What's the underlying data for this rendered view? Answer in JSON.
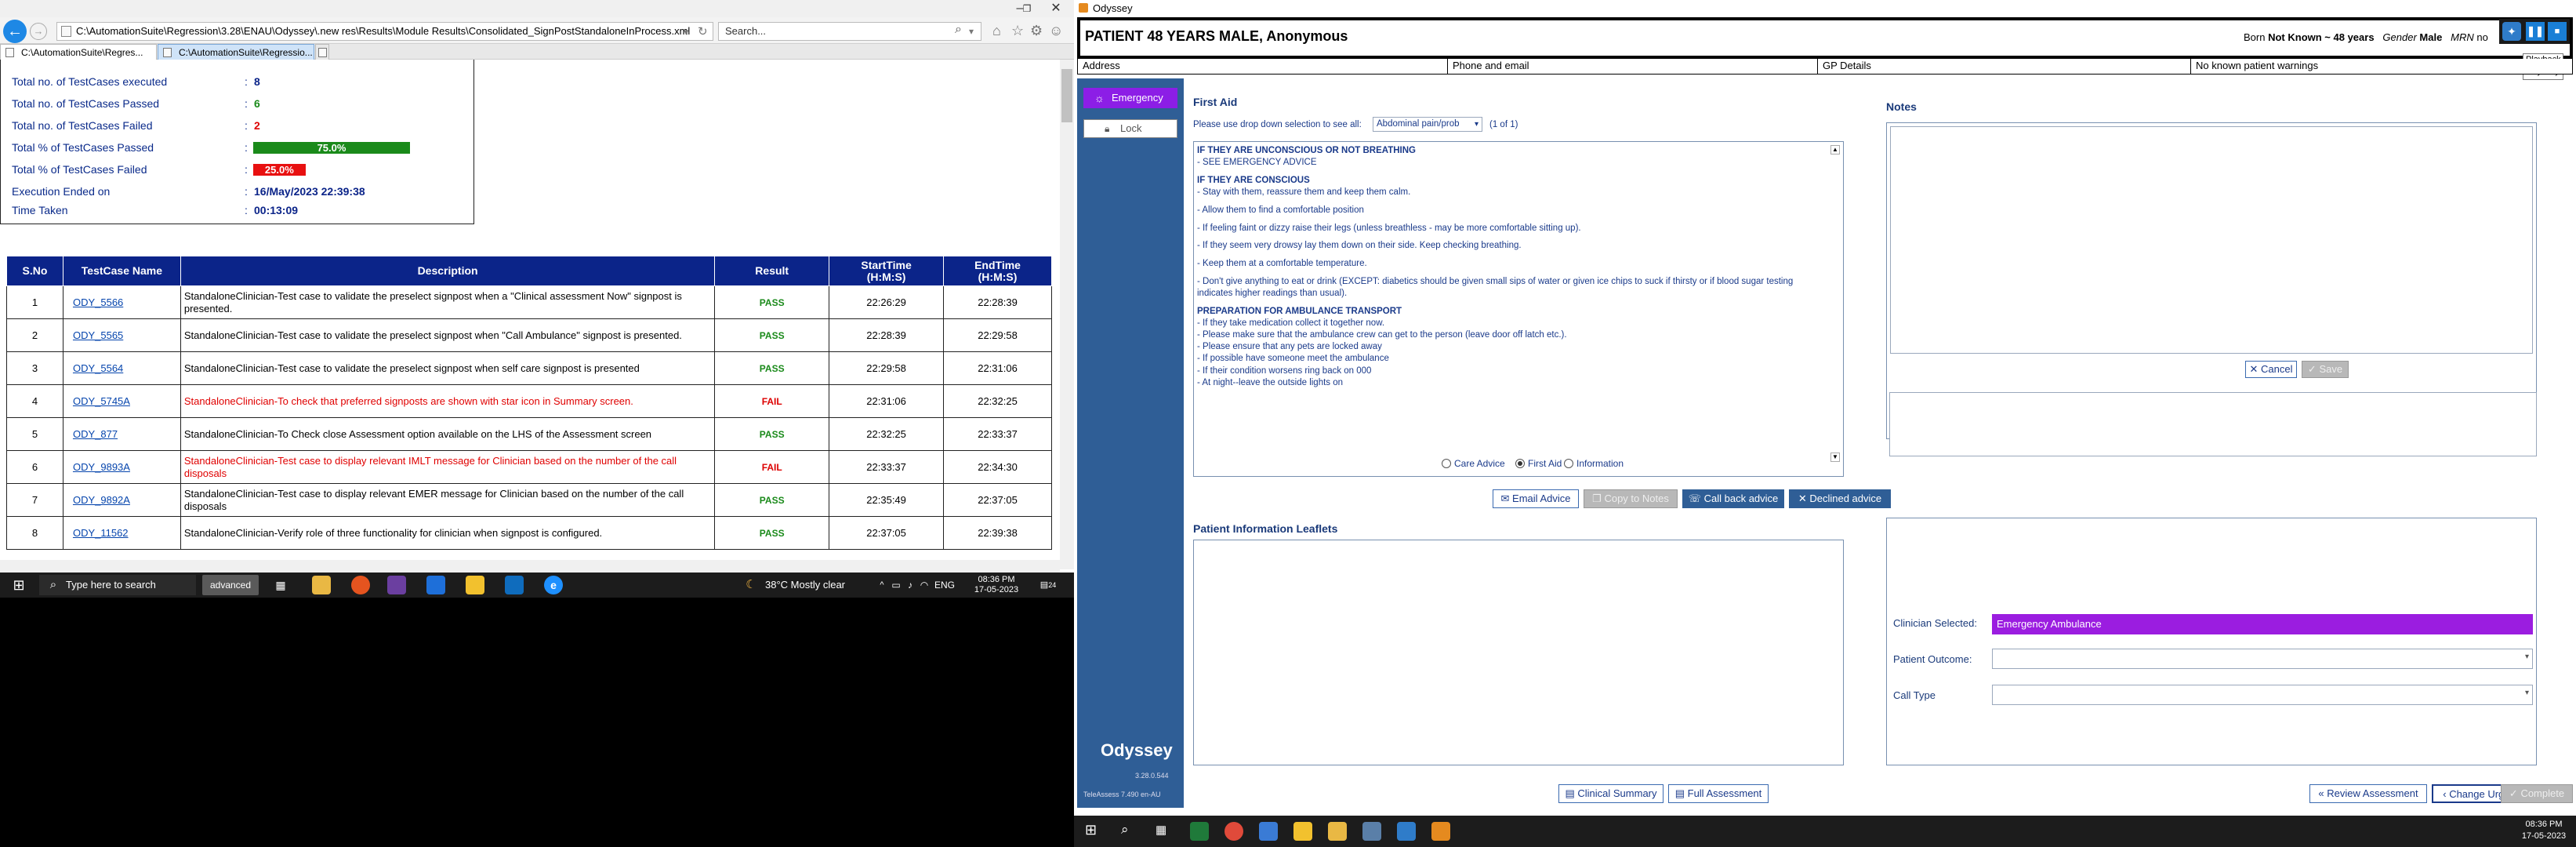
{
  "ie": {
    "address": "C:\\AutomationSuite\\Regression\\3.28\\ENAU\\Odyssey\\.new res\\Results\\Module Results\\Consolidated_SignPostStandaloneInProcess.xml",
    "search_placeholder": "Search...",
    "tabs": [
      "C:\\AutomationSuite\\Regres...",
      "C:\\AutomationSuite\\Regressio..."
    ],
    "summary": [
      {
        "label": "Total no. of TestCases executed",
        "value": "8",
        "color": "#0b2489"
      },
      {
        "label": "Total no. of TestCases Passed",
        "value": "6",
        "color": "#1a8a1a"
      },
      {
        "label": "Total no. of TestCases Failed",
        "value": "2",
        "color": "#dd0000"
      },
      {
        "label": "Total % of TestCases Passed",
        "value": "75.0%"
      },
      {
        "label": "Total % of TestCases Failed",
        "value": "25.0%"
      },
      {
        "label": "Execution Ended on",
        "value": "16/May/2023 22:39:38",
        "color": "#0b2489"
      },
      {
        "label": "Time Taken",
        "value": "00:13:09",
        "color": "#0b2489"
      }
    ],
    "pass_percent": 75.0,
    "fail_percent": 25.0,
    "pass_color": "#1a8a1a",
    "fail_color": "#e81010",
    "table": {
      "headers": [
        "S.No",
        "TestCase Name",
        "Description",
        "Result",
        "StartTime\n(H:M:S)",
        "EndTime\n(H:M:S)"
      ],
      "rows": [
        {
          "no": "1",
          "name": "ODY_5566",
          "desc": "StandaloneClinician-Test case to validate the preselect signpost when a \"Clinical assessment Now\" signpost is presented.",
          "result": "PASS",
          "start": "22:26:29",
          "end": "22:28:39"
        },
        {
          "no": "2",
          "name": "ODY_5565",
          "desc": "StandaloneClinician-Test case to validate the preselect signpost when \"Call Ambulance\" signpost is presented.",
          "result": "PASS",
          "start": "22:28:39",
          "end": "22:29:58"
        },
        {
          "no": "3",
          "name": "ODY_5564",
          "desc": "StandaloneClinician-Test case to validate the preselect signpost when self care signpost is presented",
          "result": "PASS",
          "start": "22:29:58",
          "end": "22:31:06"
        },
        {
          "no": "4",
          "name": "ODY_5745A",
          "desc": "StandaloneClinician-To check that preferred signposts are shown with star icon in Summary screen.",
          "result": "FAIL",
          "start": "22:31:06",
          "end": "22:32:25"
        },
        {
          "no": "5",
          "name": "ODY_877",
          "desc": "StandaloneClinician-To Check close Assessment option available on the LHS of the Assessment screen",
          "result": "PASS",
          "start": "22:32:25",
          "end": "22:33:37"
        },
        {
          "no": "6",
          "name": "ODY_9893A",
          "desc": "StandaloneClinician-Test case to display relevant IMLT message for Clinician based on the number of the call disposals",
          "result": "FAIL",
          "start": "22:33:37",
          "end": "22:34:30"
        },
        {
          "no": "7",
          "name": "ODY_9892A",
          "desc": "StandaloneClinician-Test case to display relevant EMER message for Clinician based on the number of the call disposals",
          "result": "PASS",
          "start": "22:35:49",
          "end": "22:37:05"
        },
        {
          "no": "8",
          "name": "ODY_11562",
          "desc": "StandaloneClinician-Verify role of three functionality for clinician when signpost is configured.",
          "result": "PASS",
          "start": "22:37:05",
          "end": "22:39:38"
        }
      ]
    }
  },
  "taskbar_left": {
    "search_placeholder": "Type here to search",
    "app_label": "advanced",
    "weather": "38°C  Mostly clear",
    "lang": "ENG",
    "time": "08:36 PM",
    "date": "17-05-2023",
    "notif": "24"
  },
  "odyssey": {
    "window_title": "Odyssey",
    "patient_title": "PATIENT 48 YEARS MALE, Anonymous",
    "born_label": "Born",
    "born_value": "Not Known ~ 48 years",
    "gender_label": "Gender",
    "gender_value": "Male",
    "mrn_label": "MRN",
    "mrn_value": "no",
    "playback_tooltip": [
      "Playback",
      "Odyssey"
    ],
    "info": {
      "address": "Address",
      "phone": "Phone and email",
      "gp": "GP Details",
      "warnings": "No known patient warnings"
    },
    "sidebar": {
      "emergency": "Emergency",
      "lock": "Lock",
      "brand": "Odyssey",
      "version": "3.28.0.544",
      "teleassess": "TeleAssess 7.490 en-AU"
    },
    "first_aid": {
      "title": "First Aid",
      "dropdown_label": "Please use drop down selection to see all:",
      "dropdown_value": "Abdominal pain/prob",
      "count": "(1 of 1)",
      "lines": [
        {
          "t": "IF THEY ARE UNCONSCIOUS OR NOT BREATHING",
          "b": true
        },
        {
          "t": "- SEE EMERGENCY ADVICE"
        },
        {
          "t": ""
        },
        {
          "t": "IF THEY ARE CONSCIOUS",
          "b": true
        },
        {
          "t": "- Stay with them, reassure them and keep them calm."
        },
        {
          "t": ""
        },
        {
          "t": "- Allow them to find a comfortable position"
        },
        {
          "t": ""
        },
        {
          "t": "- If feeling faint or dizzy raise their legs (unless breathless - may be more comfortable sitting up)."
        },
        {
          "t": ""
        },
        {
          "t": "- If they seem very drowsy lay them down on their side. Keep checking breathing."
        },
        {
          "t": ""
        },
        {
          "t": "- Keep them at a comfortable temperature."
        },
        {
          "t": ""
        },
        {
          "t": "- Don't give anything to eat or drink (EXCEPT: diabetics should be given small sips of water or given ice chips to suck if thirsty or if blood sugar testing"
        },
        {
          "t": "indicates higher readings than usual)."
        },
        {
          "t": ""
        },
        {
          "t": "PREPARATION FOR AMBULANCE TRANSPORT",
          "b": true
        },
        {
          "t": "- If they take medication collect it together now."
        },
        {
          "t": "- Please make sure that the ambulance crew can get to the person (leave door off latch etc.)."
        },
        {
          "t": "- Please ensure that any pets are locked away"
        },
        {
          "t": "- If possible have someone meet the ambulance"
        },
        {
          "t": "- If their condition worsens ring back on 000"
        },
        {
          "t": "- At night--leave the outside lights on"
        }
      ],
      "radios": [
        "Care Advice",
        "First Aid",
        "Information"
      ],
      "selected_radio": "First Aid",
      "buttons": {
        "email": "Email Advice",
        "copy": "Copy to Notes",
        "callback": "Call back advice",
        "declined": "Declined advice"
      }
    },
    "leaflets_title": "Patient Information Leaflets",
    "notes_title": "Notes",
    "notes_cancel": "Cancel",
    "notes_save": "Save",
    "clinician_label": "Clinician Selected:",
    "clinician_value": "Emergency Ambulance",
    "clinician_color": "#9b1de0",
    "outcome_label": "Patient Outcome:",
    "calltype_label": "Call Type",
    "bottom": {
      "clinical_summary": "Clinical Summary",
      "full_assessment": "Full Assessment",
      "review": "Review Assessment",
      "change_urgency": "Change Urgency",
      "complete": "Complete"
    }
  },
  "taskbar_right": {
    "time": "08:36 PM",
    "date": "17-05-2023"
  }
}
